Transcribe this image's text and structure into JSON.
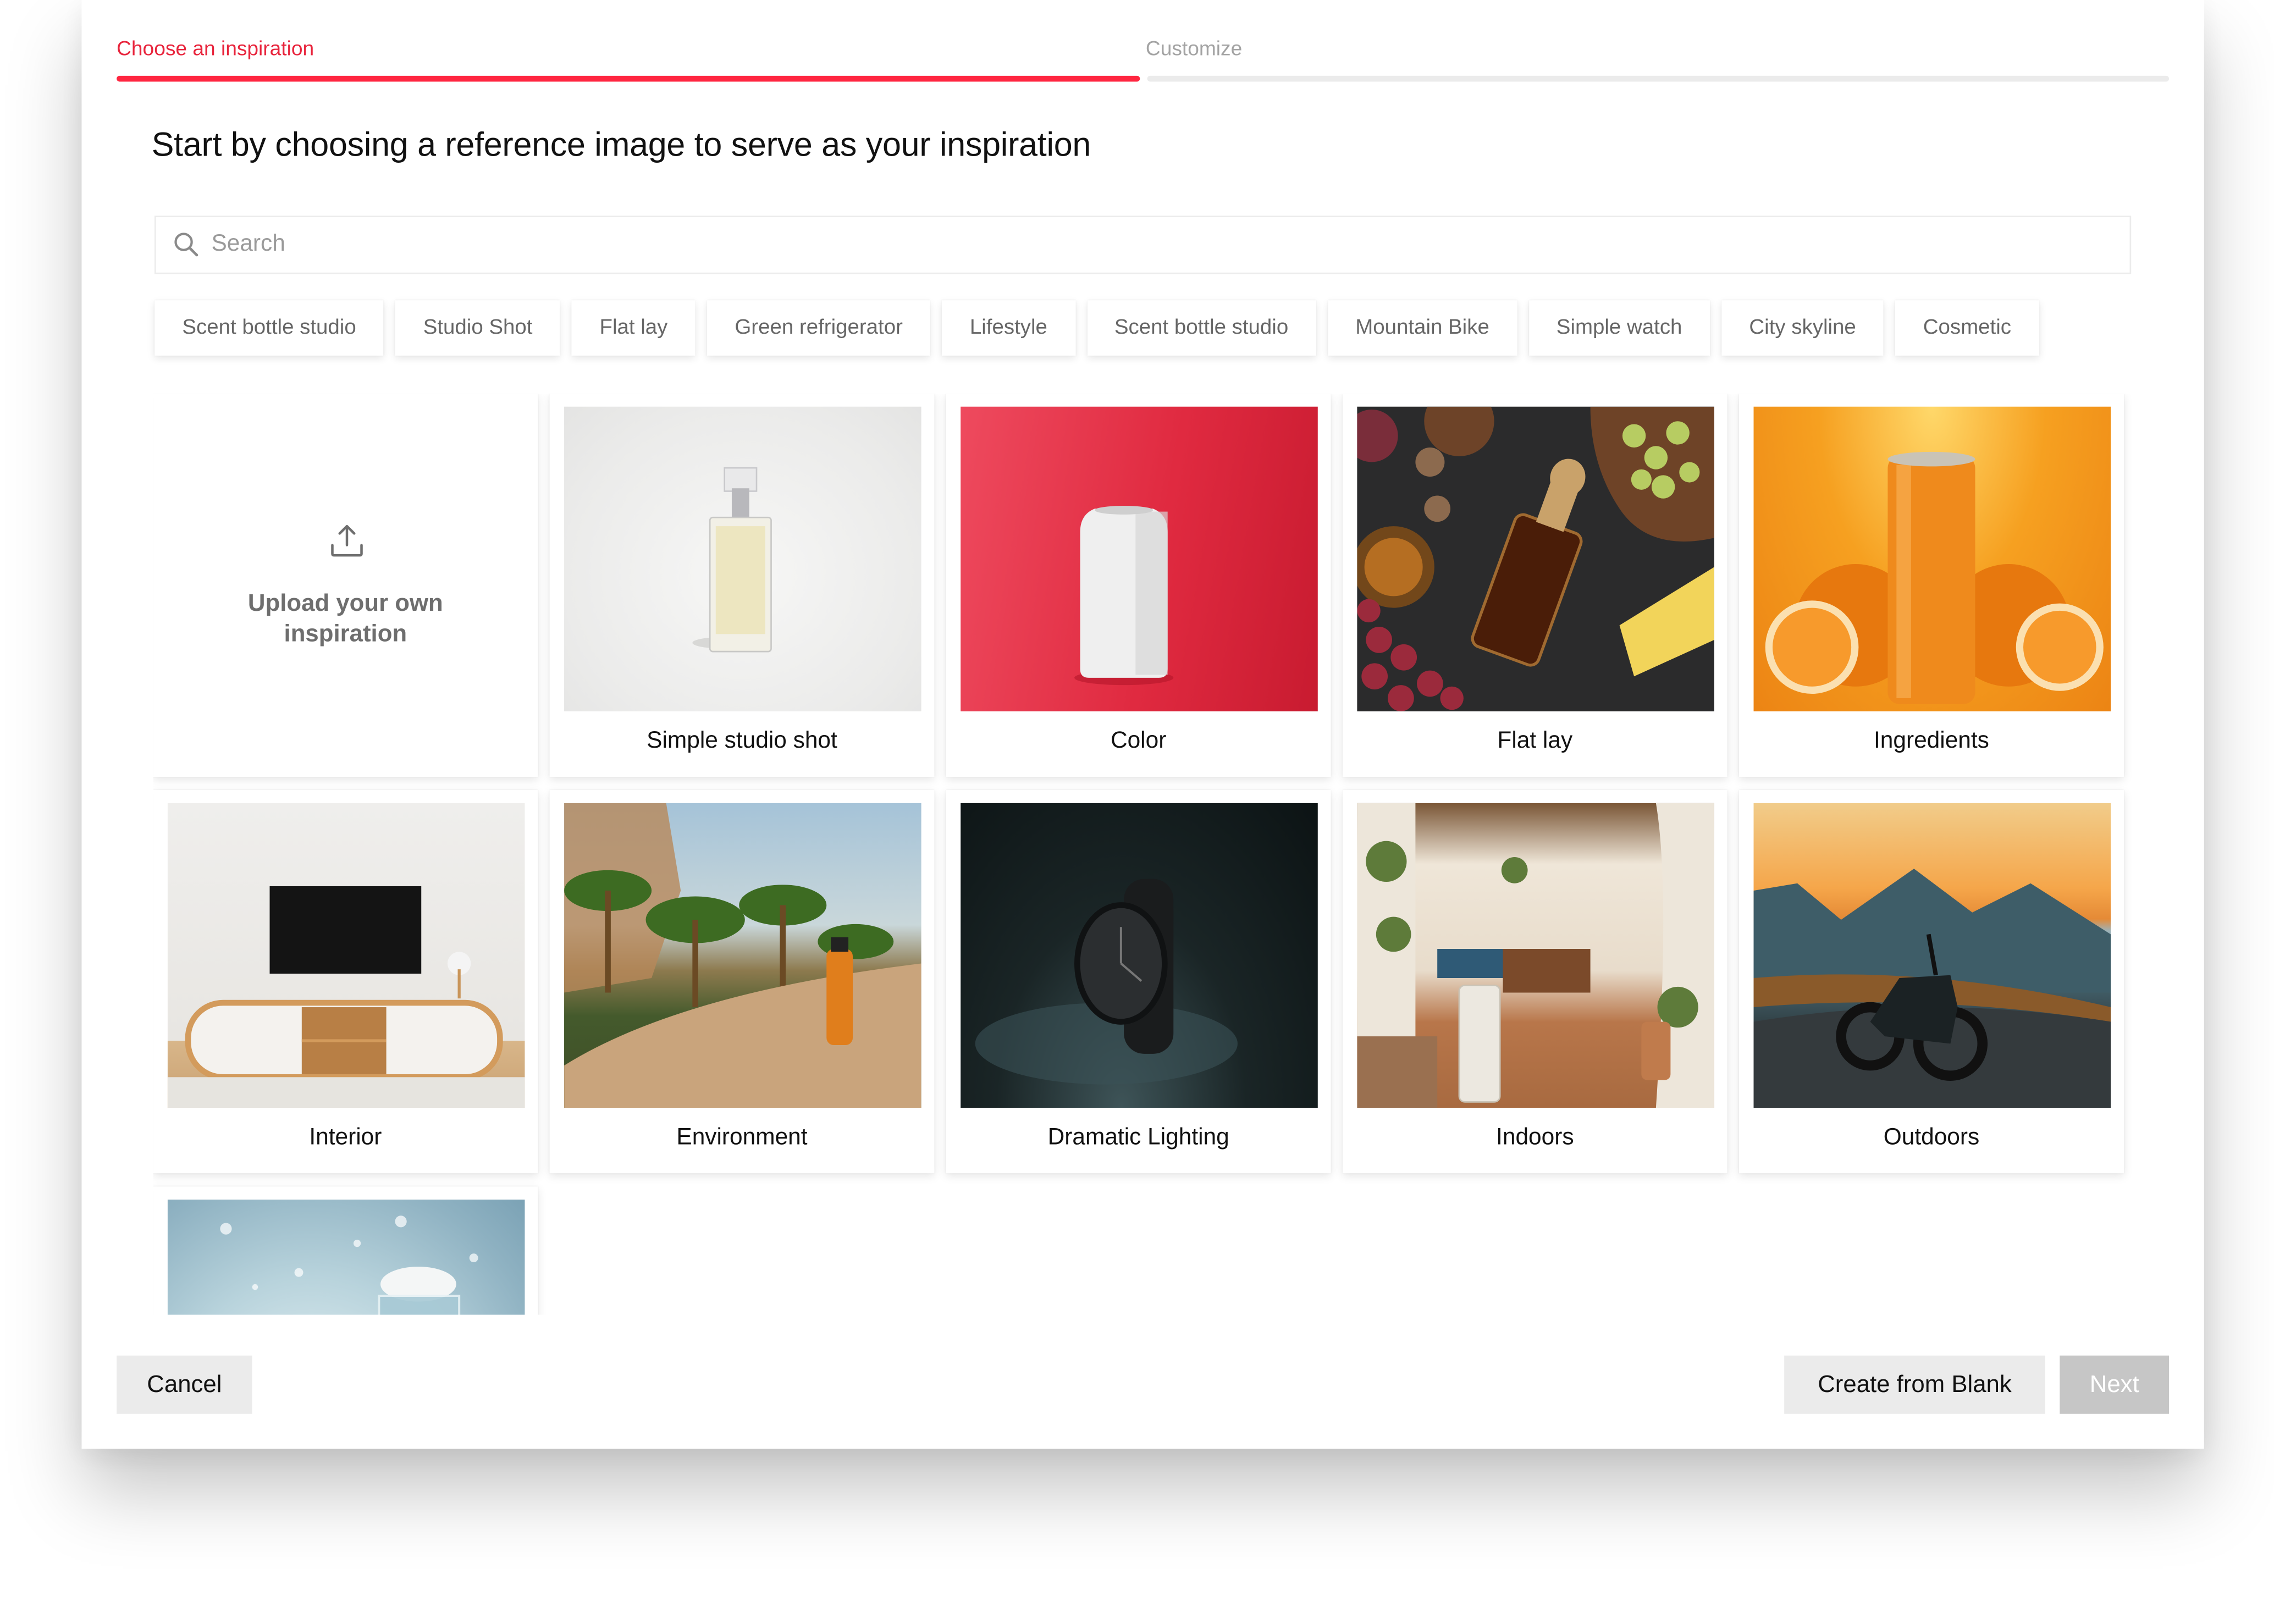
{
  "stepper": {
    "steps": [
      {
        "label": "Choose an inspiration",
        "state": "active"
      },
      {
        "label": "Customize",
        "state": "inactive"
      }
    ],
    "accent_color": "#ff2640"
  },
  "page_title": "Start by choosing a reference image to serve as your inspiration",
  "search": {
    "placeholder": "Search",
    "value": "",
    "icon": "search-icon"
  },
  "chips": [
    "Scent bottle studio",
    "Studio Shot",
    "Flat lay",
    "Green refrigerator",
    "Lifestyle",
    "Scent bottle studio",
    "Mountain Bike",
    "Simple watch",
    "City skyline",
    "Cosmetic"
  ],
  "upload_card": {
    "icon": "upload-icon",
    "label_line1": "Upload your own",
    "label_line2": "inspiration"
  },
  "inspirations": [
    {
      "label": "Simple studio shot",
      "image": "perfume bottle on white background"
    },
    {
      "label": "Color",
      "image": "white can on red background"
    },
    {
      "label": "Flat lay",
      "image": "liquor bottle with grapes and cheese on dark table"
    },
    {
      "label": "Ingredients",
      "image": "orange can with orange halves"
    },
    {
      "label": "Interior",
      "image": "TV above wooden media console"
    },
    {
      "label": "Environment",
      "image": "orange bottle on rock at desert oasis"
    },
    {
      "label": "Dramatic Lighting",
      "image": "black watch under spotlight"
    },
    {
      "label": "Indoors",
      "image": "air purifier in Mediterranean interior"
    },
    {
      "label": "Outdoors",
      "image": "motorcycle on mountain road at sunset"
    },
    {
      "label": "",
      "image": "cosmetic jar with snow, icy blue background"
    }
  ],
  "footer": {
    "cancel": "Cancel",
    "create_blank": "Create from Blank",
    "next": "Next",
    "next_disabled": true
  }
}
